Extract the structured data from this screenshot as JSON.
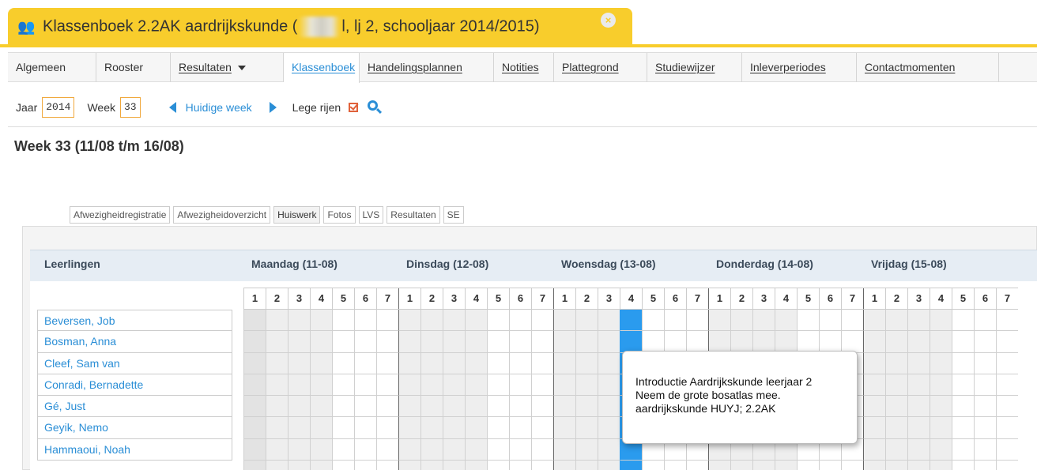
{
  "window": {
    "title_before_blur": "Klassenboek 2.2AK aardrijkskunde (",
    "title_after_blur": "l, lj 2, schooljaar 2014/2015)"
  },
  "nav": {
    "tabs": [
      {
        "label": "Algemeen",
        "underlined": false
      },
      {
        "label": "Rooster",
        "underlined": false
      },
      {
        "label": "Resultaten",
        "underlined": true,
        "dropdown": true
      },
      {
        "label": "Klassenboek",
        "underlined": true,
        "active": true
      },
      {
        "label": "Handelingsplannen",
        "underlined": true
      },
      {
        "label": "Notities",
        "underlined": true
      },
      {
        "label": "Plattegrond",
        "underlined": true
      },
      {
        "label": "Studiewijzer",
        "underlined": true
      },
      {
        "label": "Inleverperiodes",
        "underlined": true
      },
      {
        "label": "Contactmomenten",
        "underlined": true
      }
    ]
  },
  "toolbar": {
    "year_label": "Jaar",
    "year_value": "2014",
    "week_label": "Week",
    "week_value": "33",
    "current_week_link": "Huidige week",
    "empty_rows_label": "Lege rijen"
  },
  "week_title": "Week 33 (11/08 t/m 16/08)",
  "subtabs": [
    "Afwezigheidregistratie",
    "Afwezigheidoverzicht",
    "Huiswerk",
    "Fotos",
    "LVS",
    "Resultaten",
    "SE"
  ],
  "active_subtab": "Huiswerk",
  "table": {
    "students_header": "Leerlingen",
    "days": [
      "Maandag (11-08)",
      "Dinsdag (12-08)",
      "Woensdag (13-08)",
      "Donderdag (14-08)",
      "Vrijdag (15-08)"
    ],
    "periods": [
      "1",
      "2",
      "3",
      "4",
      "5",
      "6",
      "7"
    ],
    "students": [
      "Beversen, Job",
      "Bosman, Anna",
      "Cleef, Sam van",
      "Conradi, Bernadette",
      "Gé, Just",
      "Geyik, Nemo",
      "Hammaoui, Noah"
    ]
  },
  "tooltip": {
    "lines": [
      "Introductie Aardrijkskunde leerjaar 2",
      "Neem de grote bosatlas mee.",
      "aardrijkskunde HUYJ; 2.2AK"
    ]
  },
  "colors": {
    "accent_yellow": "#f8cd2c",
    "link_blue": "#2a8ed6",
    "selected_cell": "#2a9bee"
  }
}
